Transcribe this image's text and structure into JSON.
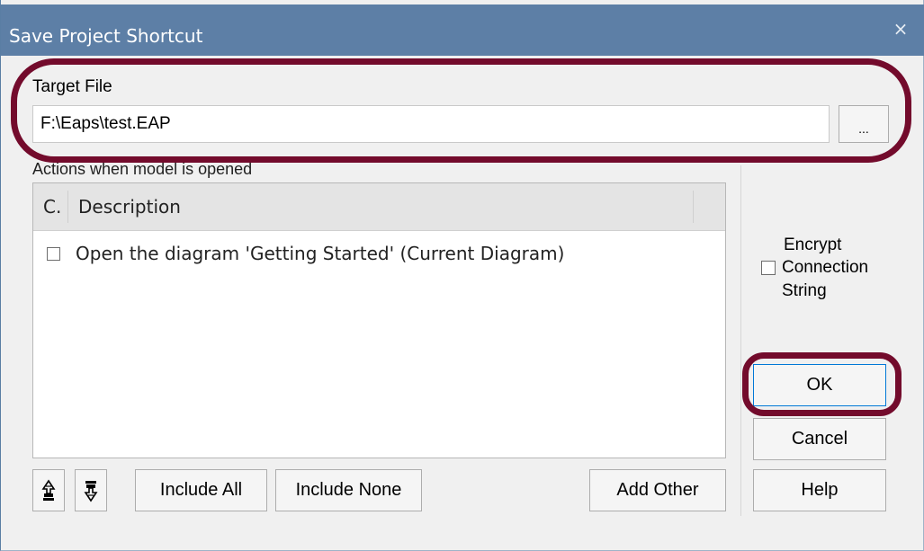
{
  "window": {
    "title": "Save Project Shortcut",
    "close_glyph": "×"
  },
  "target_file": {
    "label": "Target File",
    "value": "F:\\Eaps\\test.EAP",
    "browse_label": "..."
  },
  "actions": {
    "label": "Actions when model is opened",
    "columns": [
      "C.",
      "Description"
    ],
    "rows": [
      {
        "checked": false,
        "description": "Open the diagram 'Getting Started' (Current Diagram)"
      }
    ]
  },
  "encrypt": {
    "checked": false,
    "label_line1": "Encrypt",
    "label_line2": "Connection",
    "label_line3": "String"
  },
  "buttons": {
    "ok": "OK",
    "cancel": "Cancel",
    "help": "Help",
    "include_all": "Include All",
    "include_none": "Include None",
    "add_other": "Add Other",
    "move_up_icon": "move-up-icon",
    "move_down_icon": "move-down-icon"
  },
  "colors": {
    "titlebar": "#5d7fa6",
    "highlight": "#730b2c"
  }
}
